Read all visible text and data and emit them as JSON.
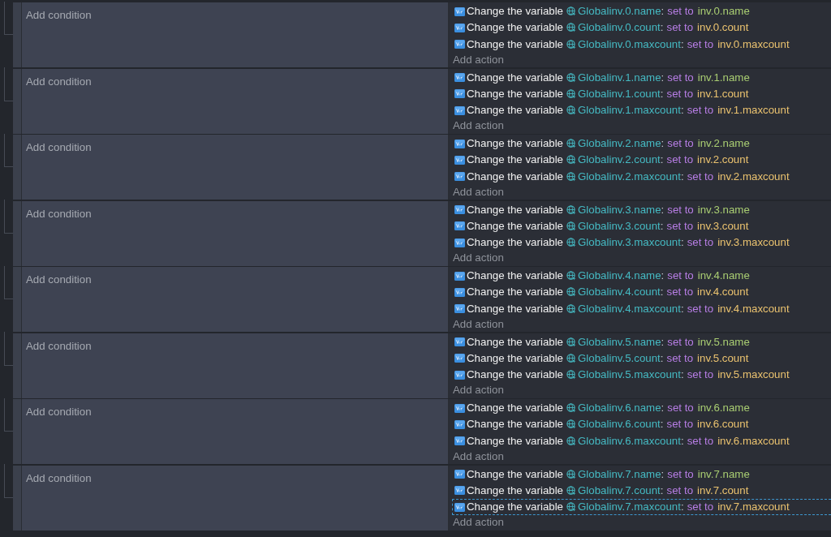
{
  "events": [
    {
      "add_condition": "Add condition",
      "add_action": "Add action",
      "actions": [
        {
          "kind": "string",
          "label": "Change the variable",
          "variable": "Globalinv.0.name",
          "separator": ":",
          "operation": "set to",
          "value": "inv.0.name",
          "selected": false
        },
        {
          "kind": "number",
          "label": "Change the variable",
          "variable": "Globalinv.0.count",
          "separator": ":",
          "operation": "set to",
          "value": "inv.0.count",
          "selected": false
        },
        {
          "kind": "number",
          "label": "Change the variable",
          "variable": "Globalinv.0.maxcount",
          "separator": ":",
          "operation": "set to",
          "value": "inv.0.maxcount",
          "selected": false
        }
      ]
    },
    {
      "add_condition": "Add condition",
      "add_action": "Add action",
      "actions": [
        {
          "kind": "string",
          "label": "Change the variable",
          "variable": "Globalinv.1.name",
          "separator": ":",
          "operation": "set to",
          "value": "inv.1.name",
          "selected": false
        },
        {
          "kind": "number",
          "label": "Change the variable",
          "variable": "Globalinv.1.count",
          "separator": ":",
          "operation": "set to",
          "value": "inv.1.count",
          "selected": false
        },
        {
          "kind": "number",
          "label": "Change the variable",
          "variable": "Globalinv.1.maxcount",
          "separator": ":",
          "operation": "set to",
          "value": "inv.1.maxcount",
          "selected": false
        }
      ]
    },
    {
      "add_condition": "Add condition",
      "add_action": "Add action",
      "actions": [
        {
          "kind": "string",
          "label": "Change the variable",
          "variable": "Globalinv.2.name",
          "separator": ":",
          "operation": "set to",
          "value": "inv.2.name",
          "selected": false
        },
        {
          "kind": "number",
          "label": "Change the variable",
          "variable": "Globalinv.2.count",
          "separator": ":",
          "operation": "set to",
          "value": "inv.2.count",
          "selected": false
        },
        {
          "kind": "number",
          "label": "Change the variable",
          "variable": "Globalinv.2.maxcount",
          "separator": ":",
          "operation": "set to",
          "value": "inv.2.maxcount",
          "selected": false
        }
      ]
    },
    {
      "add_condition": "Add condition",
      "add_action": "Add action",
      "actions": [
        {
          "kind": "string",
          "label": "Change the variable",
          "variable": "Globalinv.3.name",
          "separator": ":",
          "operation": "set to",
          "value": "inv.3.name",
          "selected": false
        },
        {
          "kind": "number",
          "label": "Change the variable",
          "variable": "Globalinv.3.count",
          "separator": ":",
          "operation": "set to",
          "value": "inv.3.count",
          "selected": false
        },
        {
          "kind": "number",
          "label": "Change the variable",
          "variable": "Globalinv.3.maxcount",
          "separator": ":",
          "operation": "set to",
          "value": "inv.3.maxcount",
          "selected": false
        }
      ]
    },
    {
      "add_condition": "Add condition",
      "add_action": "Add action",
      "actions": [
        {
          "kind": "string",
          "label": "Change the variable",
          "variable": "Globalinv.4.name",
          "separator": ":",
          "operation": "set to",
          "value": "inv.4.name",
          "selected": false
        },
        {
          "kind": "number",
          "label": "Change the variable",
          "variable": "Globalinv.4.count",
          "separator": ":",
          "operation": "set to",
          "value": "inv.4.count",
          "selected": false
        },
        {
          "kind": "number",
          "label": "Change the variable",
          "variable": "Globalinv.4.maxcount",
          "separator": ":",
          "operation": "set to",
          "value": "inv.4.maxcount",
          "selected": false
        }
      ]
    },
    {
      "add_condition": "Add condition",
      "add_action": "Add action",
      "actions": [
        {
          "kind": "string",
          "label": "Change the variable",
          "variable": "Globalinv.5.name",
          "separator": ":",
          "operation": "set to",
          "value": "inv.5.name",
          "selected": false
        },
        {
          "kind": "number",
          "label": "Change the variable",
          "variable": "Globalinv.5.count",
          "separator": ":",
          "operation": "set to",
          "value": "inv.5.count",
          "selected": false
        },
        {
          "kind": "number",
          "label": "Change the variable",
          "variable": "Globalinv.5.maxcount",
          "separator": ":",
          "operation": "set to",
          "value": "inv.5.maxcount",
          "selected": false
        }
      ]
    },
    {
      "add_condition": "Add condition",
      "add_action": "Add action",
      "actions": [
        {
          "kind": "string",
          "label": "Change the variable",
          "variable": "Globalinv.6.name",
          "separator": ":",
          "operation": "set to",
          "value": "inv.6.name",
          "selected": false
        },
        {
          "kind": "number",
          "label": "Change the variable",
          "variable": "Globalinv.6.count",
          "separator": ":",
          "operation": "set to",
          "value": "inv.6.count",
          "selected": false
        },
        {
          "kind": "number",
          "label": "Change the variable",
          "variable": "Globalinv.6.maxcount",
          "separator": ":",
          "operation": "set to",
          "value": "inv.6.maxcount",
          "selected": false
        }
      ]
    },
    {
      "add_condition": "Add condition",
      "add_action": "Add action",
      "actions": [
        {
          "kind": "string",
          "label": "Change the variable",
          "variable": "Globalinv.7.name",
          "separator": ":",
          "operation": "set to",
          "value": "inv.7.name",
          "selected": false
        },
        {
          "kind": "number",
          "label": "Change the variable",
          "variable": "Globalinv.7.count",
          "separator": ":",
          "operation": "set to",
          "value": "inv.7.count",
          "selected": false
        },
        {
          "kind": "number",
          "label": "Change the variable",
          "variable": "Globalinv.7.maxcount",
          "separator": ":",
          "operation": "set to",
          "value": "inv.7.maxcount",
          "selected": true
        }
      ]
    }
  ]
}
